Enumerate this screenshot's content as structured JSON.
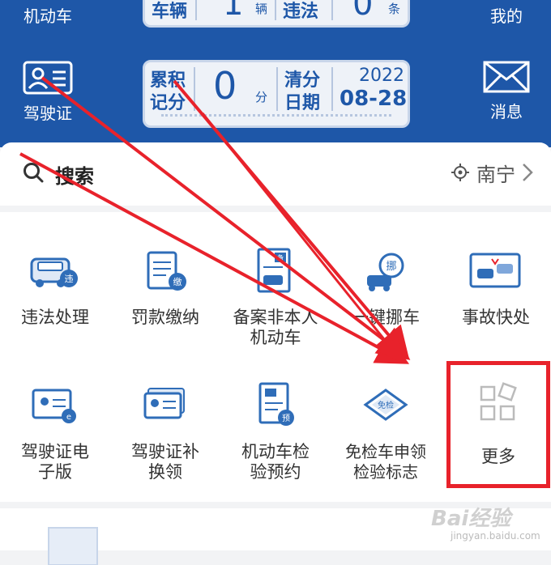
{
  "header": {
    "row1": {
      "left_label": "机动车",
      "vehicle_label": "车辆",
      "vehicle_count": "1",
      "vehicle_unit": "辆",
      "violation_label": "违法",
      "violation_count": "0",
      "violation_unit": "条",
      "right_label": "我的"
    },
    "row2": {
      "license_label": "驾驶证",
      "points_label_1": "累积",
      "points_label_2": "记分",
      "points_value": "0",
      "points_unit": "分",
      "clear_label_1": "清分",
      "clear_label_2": "日期",
      "clear_year": "2022",
      "clear_date": "08-28",
      "message_label": "消息"
    }
  },
  "search": {
    "placeholder": "搜索",
    "location": "南宁"
  },
  "services": [
    {
      "label": "违法处理",
      "icon": "car-violation-icon"
    },
    {
      "label": "罚款缴纳",
      "icon": "fine-payment-icon"
    },
    {
      "label": "备案非本人机动车",
      "icon": "register-vehicle-icon"
    },
    {
      "label": "一键挪车",
      "icon": "move-car-icon"
    },
    {
      "label": "事故快处",
      "icon": "accident-icon"
    },
    {
      "label": "驾驶证电子版",
      "icon": "e-license-icon"
    },
    {
      "label": "驾驶证补换领",
      "icon": "license-renew-icon"
    },
    {
      "label": "机动车检验预约",
      "icon": "inspection-booking-icon"
    },
    {
      "label": "免检车申领检验标志",
      "icon": "exempt-sticker-icon"
    },
    {
      "label": "更多",
      "icon": "more-grid-icon"
    }
  ],
  "watermark": {
    "brand": "Bai经验",
    "url": "jingyan.baidu.com"
  },
  "colors": {
    "primary": "#1e57a8",
    "highlight": "#e8222b",
    "icon_blue": "#2f6db8"
  }
}
